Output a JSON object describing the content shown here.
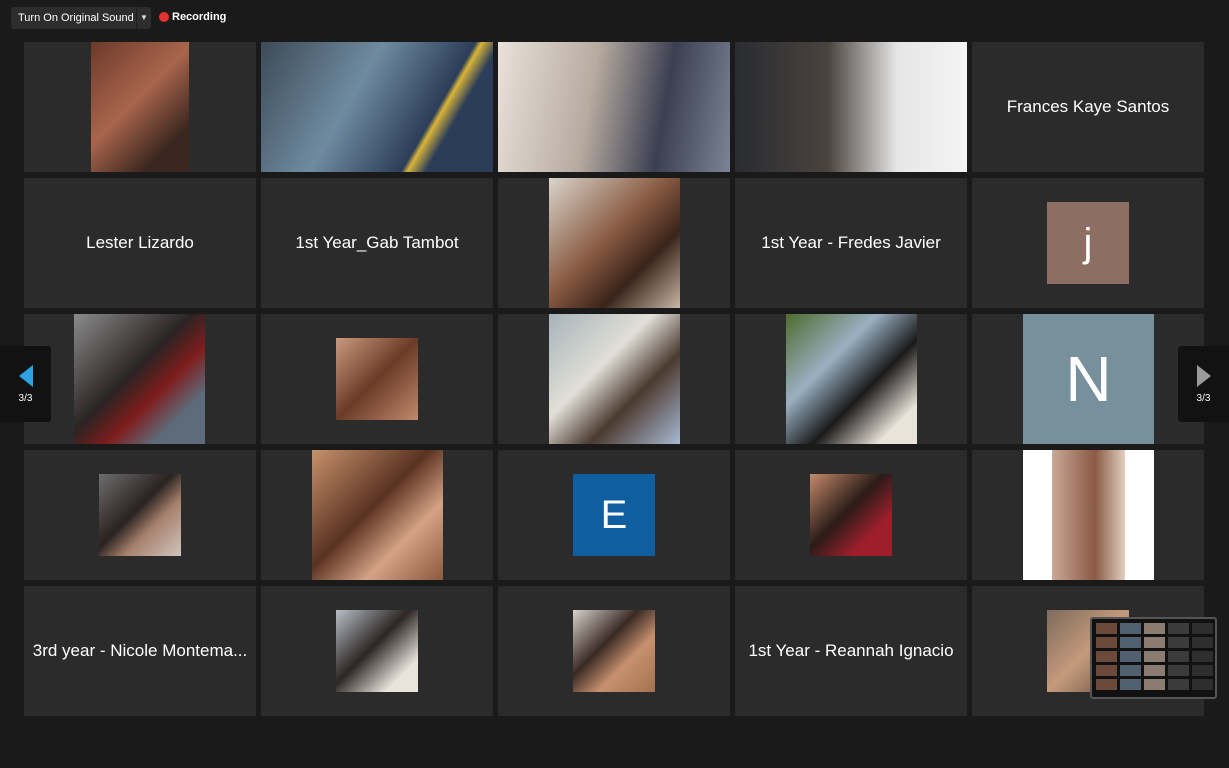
{
  "toolbar": {
    "original_sound_label": "Turn On Original Sound",
    "recording_label": "Recording"
  },
  "pager": {
    "left_label": "3/3",
    "right_label": "3/3"
  },
  "participants": {
    "frances": "Frances Kaye Santos",
    "lester": "Lester Lizardo",
    "gab": "1st Year_Gab Tambot",
    "fredes": "1st Year - Fredes Javier",
    "nicole": "3rd year - Nicole Montema...",
    "reannah": "1st Year - Reannah Ignacio"
  },
  "avatars": {
    "j": {
      "letter": "j",
      "color": "#8c6e62"
    },
    "n": {
      "letter": "N",
      "color": "#77909b"
    },
    "e": {
      "letter": "E",
      "color": "#0f5e9f"
    }
  },
  "colors": {
    "recording_dot": "#e5322d",
    "nav_arrow_active": "#2da3e6",
    "tile_bg": "#2b2b2b"
  }
}
